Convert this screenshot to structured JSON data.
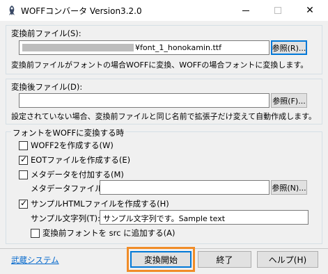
{
  "window": {
    "title": "WOFFコンバータ Version3.2.0"
  },
  "source": {
    "label": "変換前ファイル(S):",
    "path": "¥font_1_honokamin.ttf",
    "browse_label": "参照(R)...",
    "hint": "変換前ファイルがフォントの場合WOFFに変換、WOFFの場合フォントに変換します。"
  },
  "dest": {
    "label": "変換後ファイル(D):",
    "path": "",
    "browse_label": "参照(F)...",
    "hint": "設定されていない場合、変換前ファイルと同じ名前で拡張子だけ変えて自動作成します。"
  },
  "options": {
    "group_label": "フォントをWOFFに変換する時",
    "woff2": {
      "label": "WOFF2を作成する(W)",
      "checked": false
    },
    "eot": {
      "label": "EOTファイルを作成する(E)",
      "checked": true
    },
    "metadata": {
      "label": "メタデータを付加する(M)",
      "checked": false
    },
    "metadata_file_label": "メタデータファイル(I):",
    "metadata_file_value": "",
    "metadata_browse_label": "参照(N)...",
    "sample_html": {
      "label": "サンプルHTMLファイルを作成する(H)",
      "checked": true
    },
    "sample_text_label": "サンプル文字列(T):",
    "sample_text_value": "サンプル文字列です。Sample text",
    "add_src": {
      "label": "変換前フォントを src に追加する(A)",
      "checked": false
    }
  },
  "footer": {
    "link_label": "武蔵システム",
    "start_label": "変換開始",
    "exit_label": "終了",
    "help_label": "ヘルプ(H)"
  },
  "colors": {
    "highlight": "#f08c28",
    "link": "#0066cc",
    "focus": "#0078d7"
  }
}
